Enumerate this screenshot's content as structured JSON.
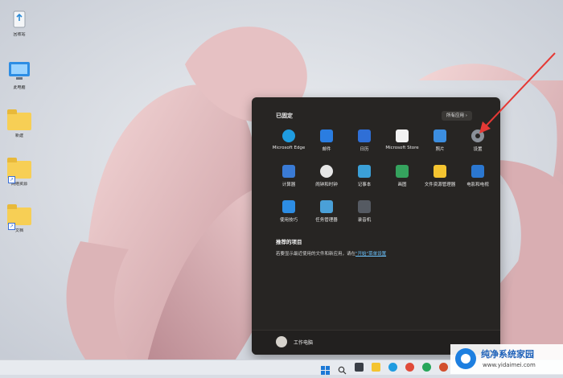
{
  "desktop": {
    "icons": [
      {
        "label": "回收站",
        "type": "recycle"
      },
      {
        "label": "此电脑",
        "type": "computer"
      },
      {
        "label": "新建",
        "type": "folder"
      },
      {
        "label": "网络资源",
        "type": "folder"
      },
      {
        "label": "文档",
        "type": "folder"
      }
    ]
  },
  "start_menu": {
    "pinned_title": "已固定",
    "all_apps_label": "所有应用 ›",
    "apps": [
      {
        "label": "Microsoft Edge",
        "icon": "edge-icon",
        "color": "#1f9ce0"
      },
      {
        "label": "邮件",
        "icon": "mail-icon",
        "color": "#2a7de1"
      },
      {
        "label": "日历",
        "icon": "calendar-icon",
        "color": "#2f6fd6"
      },
      {
        "label": "Microsoft Store",
        "icon": "store-icon",
        "color": "#f2f2f2"
      },
      {
        "label": "照片",
        "icon": "photos-icon",
        "color": "#3c8ee0"
      },
      {
        "label": "设置",
        "icon": "gear-icon",
        "color": "#8a9099"
      },
      {
        "label": "计算器",
        "icon": "calculator-icon",
        "color": "#3a7bd5"
      },
      {
        "label": "闹钟和时钟",
        "icon": "clock-icon",
        "color": "#e6e6e6"
      },
      {
        "label": "记事本",
        "icon": "notepad-icon",
        "color": "#3ba0d8"
      },
      {
        "label": "画图",
        "icon": "paint-icon",
        "color": "#35a35e"
      },
      {
        "label": "文件资源管理器",
        "icon": "folder-icon",
        "color": "#f4c430"
      },
      {
        "label": "电影和电视",
        "icon": "movies-icon",
        "color": "#2b77d0"
      },
      {
        "label": "使用技巧",
        "icon": "tips-icon",
        "color": "#2d8de4"
      },
      {
        "label": "任务管理器",
        "icon": "task-manager-icon",
        "color": "#4aa0d8"
      },
      {
        "label": "录音机",
        "icon": "recorder-icon",
        "color": "#555a62"
      }
    ],
    "recommended_title": "推荐的项目",
    "recommended_text": "若要显示最近使用的文件和新应用，请在",
    "recommended_link": "\"开始\"菜单设置",
    "user_name": "工作电脑"
  },
  "annotation": {
    "arrow_color": "#e53935"
  },
  "watermark": {
    "title": "纯净系统家园",
    "url": "www.yidaimei.com"
  }
}
